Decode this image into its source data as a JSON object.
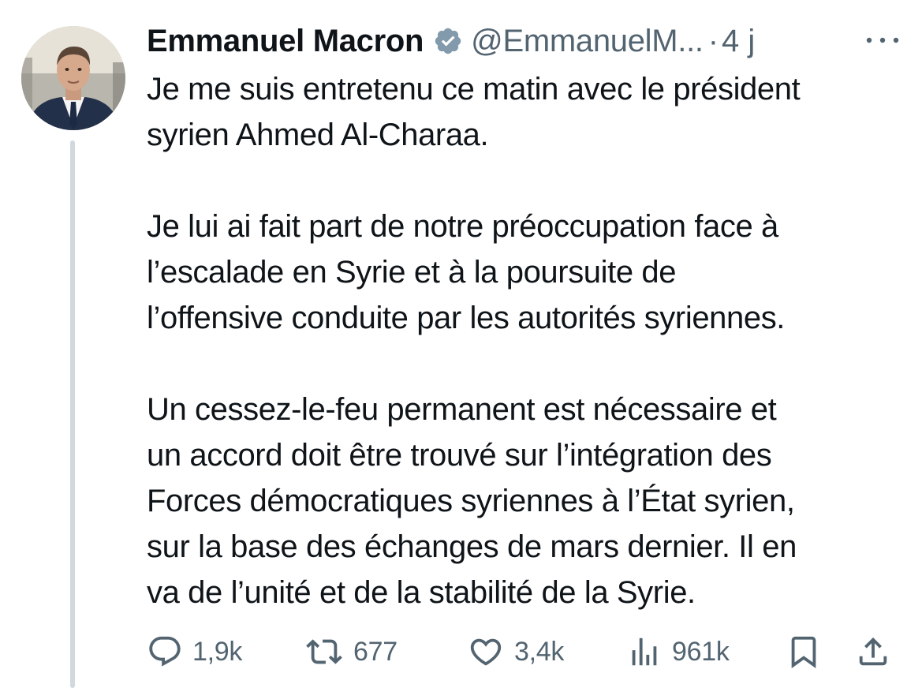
{
  "author": {
    "display_name": "Emmanuel Macron",
    "handle": "@EmmanuelM...",
    "separator": "·",
    "time": "4 j"
  },
  "tweet": {
    "paragraphs": [
      [
        "Je me suis entretenu ce matin avec le président",
        "syrien Ahmed Al-Charaa."
      ],
      [
        "Je lui ai fait part de notre préoccupation face à",
        "l’escalade en Syrie et à la poursuite de",
        "l’offensive conduite par les autorités syriennes."
      ],
      [
        "Un cessez-le-feu permanent est nécessaire et",
        "un accord doit être trouvé sur l’intégration des",
        "Forces démocratiques syriennes à l’État syrien,",
        "sur la base des échanges de mars dernier. Il en",
        "va de l’unité et de la stabilité de la Syrie."
      ]
    ]
  },
  "actions": {
    "replies": "1,9k",
    "reposts": "677",
    "likes": "3,4k",
    "views": "961k"
  },
  "icons": {
    "verified": "verified-badge-icon",
    "more": "more-options-icon",
    "reply": "reply-icon",
    "repost": "repost-icon",
    "like": "like-icon",
    "views": "views-icon",
    "bookmark": "bookmark-icon",
    "share": "share-icon"
  },
  "colors": {
    "text": "#0f1419",
    "secondary": "#536471",
    "thread_line": "#cfd9de"
  }
}
